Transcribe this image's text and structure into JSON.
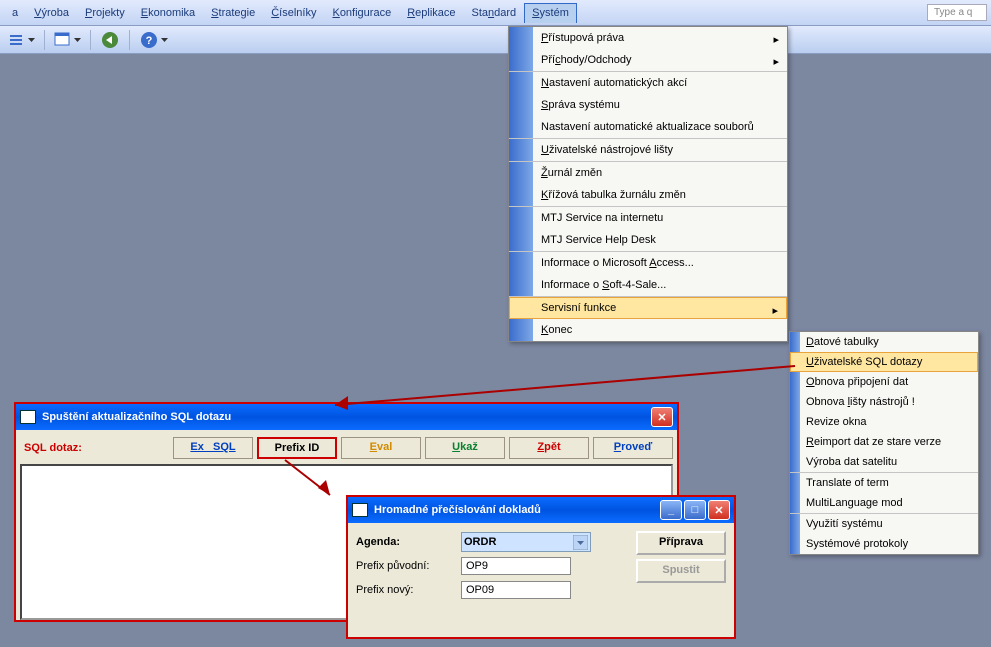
{
  "menubar": {
    "items": [
      {
        "label": "a",
        "ul": ""
      },
      {
        "label": "Výroba",
        "ul": "V"
      },
      {
        "label": "Projekty",
        "ul": "P"
      },
      {
        "label": "Ekonomika",
        "ul": "E"
      },
      {
        "label": "Strategie",
        "ul": "S"
      },
      {
        "label": "Číselníky",
        "ul": "Č"
      },
      {
        "label": "Konfigurace",
        "ul": "K"
      },
      {
        "label": "Replikace",
        "ul": "R"
      },
      {
        "label": "Standard",
        "ul": "n"
      },
      {
        "label": "Systém",
        "ul": "S"
      }
    ],
    "type_placeholder": "Type a q"
  },
  "system_menu": [
    {
      "label": "Přístupová práva",
      "ul": "P",
      "sub": true
    },
    {
      "label": "Příchody/Odchody",
      "ul": "c",
      "sub": true,
      "sep": true
    },
    {
      "label": "Nastavení automatických akcí",
      "ul": "N"
    },
    {
      "label": "Správa systému",
      "ul": "S"
    },
    {
      "label": "Nastavení automatické aktualizace souborů",
      "sep": true
    },
    {
      "label": "Uživatelské nástrojové lišty",
      "ul": "U",
      "sep": true
    },
    {
      "label": "Žurnál změn",
      "ul": "Ž"
    },
    {
      "label": "Křížová tabulka žurnálu změn",
      "ul": "K",
      "sep": true
    },
    {
      "label": "MTJ Service na internetu"
    },
    {
      "label": "MTJ Service Help Desk",
      "sep": true
    },
    {
      "label": "Informace o Microsoft Access...",
      "ul": "A"
    },
    {
      "label": "Informace o Soft-4-Sale...",
      "ul": "S",
      "sep": true
    },
    {
      "label": "Servisní funkce",
      "sub": true,
      "highlight": true,
      "sep": true
    },
    {
      "label": "Konec",
      "ul": "K"
    }
  ],
  "servis_submenu": [
    {
      "label": "Datové tabulky",
      "ul": "D"
    },
    {
      "label": "Uživatelské SQL dotazy",
      "ul": "U",
      "highlight": true
    },
    {
      "label": "Obnova připojení dat",
      "ul": "O"
    },
    {
      "label": "Obnova lišty nástrojů !",
      "ul": "l"
    },
    {
      "label": "Revize okna"
    },
    {
      "label": "Reimport dat ze stare verze",
      "ul": "R"
    },
    {
      "label": "Výroba dat satelitu",
      "sep": true
    },
    {
      "label": "Translate of term"
    },
    {
      "label": "MultiLanguage mod",
      "sep": true
    },
    {
      "label": "Využití systému"
    },
    {
      "label": "Systémové protokoly"
    }
  ],
  "sql_window": {
    "title": "Spuštění aktualizačního SQL dotazu",
    "label": "SQL dotaz:",
    "buttons": {
      "ex_sql": "Ex_ SQL",
      "prefix_id": "Prefix ID",
      "eval": "Eval",
      "ukaz": "Ukaž",
      "zpet": "Zpět",
      "proved": "Proveď"
    }
  },
  "renum_window": {
    "title": "Hromadné přečíslování dokladů",
    "agenda_label": "Agenda:",
    "agenda_value": "ORDR",
    "prefix_old_label": "Prefix původní:",
    "prefix_old_value": "OP9",
    "prefix_new_label": "Prefix nový:",
    "prefix_new_value": "OP09",
    "priprava": "Příprava",
    "spustit": "Spustit"
  }
}
